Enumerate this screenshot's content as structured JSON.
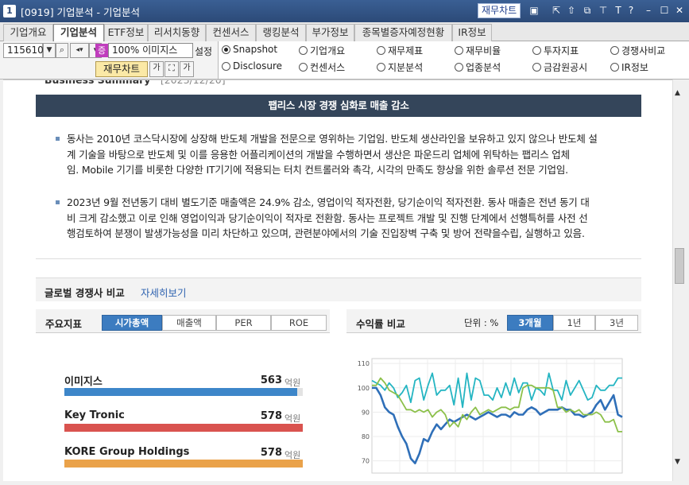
{
  "window": {
    "num": "1",
    "title": "[0919] 기업분석 - 기업분석",
    "fin_chart_btn": "재무차트",
    "icons": [
      "chart-icon",
      "arrow-up-icon",
      "window-icon",
      "window-icon-2",
      "pin-icon",
      "font-icon",
      "help-icon",
      "minimize-icon",
      "maximize-icon",
      "close-icon"
    ]
  },
  "tabs": [
    "기업개요",
    "기업분석",
    "ETF정보",
    "리서치동향",
    "컨센서스",
    "랭킹분석",
    "부가정보",
    "종목별증자예정현황",
    "IR정보"
  ],
  "active_tab": "기업분석",
  "controls": {
    "code": "115610",
    "zoom": "100%",
    "zoom_prefix": "증",
    "company": "이미지스",
    "settings": "설정",
    "fin_chart": "재무차트",
    "small_btns": [
      "가",
      "⛶",
      "가"
    ]
  },
  "radios": [
    {
      "label": "Snapshot",
      "checked": true
    },
    {
      "label": "기업개요",
      "checked": false
    },
    {
      "label": "재무제표",
      "checked": false
    },
    {
      "label": "재무비율",
      "checked": false
    },
    {
      "label": "투자지표",
      "checked": false
    },
    {
      "label": "경쟁사비교",
      "checked": false
    },
    {
      "label": "Disclosure",
      "checked": false
    },
    {
      "label": "컨센서스",
      "checked": false
    },
    {
      "label": "지분분석",
      "checked": false
    },
    {
      "label": "업종분석",
      "checked": false
    },
    {
      "label": "금감원공시",
      "checked": false
    },
    {
      "label": "IR정보",
      "checked": false
    }
  ],
  "summary": {
    "heading": "Business Summary",
    "date": "[2023/12/20]",
    "banner": "팹리스 시장 경쟁 심화로 매출 감소",
    "para1": [
      "동사는 2010년 코스닥시장에 상장해 반도체 개발을 전문으로 영위하는 기업임. 반도체 생산라인을 보유하고 있지 않으나 반도체 설",
      "계 기술을 바탕으로 반도체 및 이를 응용한 어플리케이션의 개발을 수행하면서 생산은 파운드리 업체에 위탁하는 팹리스 업체",
      "임. Mobile 기기를 비롯한 다양한 IT기기에 적용되는 터치 컨트롤러와 촉각, 시각의 만족도 향상을 위한 솔루션 전문 기업임."
    ],
    "para2": [
      "2023년 9월 전년동기 대비 별도기준 매출액은 24.9% 감소, 영업이익 적자전환, 당기순이익 적자전환. 동사 매출은 전년 동기 대",
      "비 크게 감소했고 이로 인해 영업이익과 당기순이익이 적자로 전환함. 동사는 프로젝트 개발 및 진행 단계에서 선행특허를 사전 선",
      "행검토하여 분쟁이 발생가능성을 미리 차단하고 있으며, 관련분야에서의 기술 진입장벽 구축 및 방어 전략을수립, 실행하고 있음."
    ]
  },
  "global": {
    "title": "글로벌 경쟁사 비교",
    "more": "자세히보기"
  },
  "indicators": {
    "title": "주요지표",
    "tabs": [
      "시가총액",
      "매출액",
      "PER",
      "ROE"
    ],
    "active": "시가총액",
    "unit": "억원",
    "companies": [
      {
        "name": "이미지스",
        "value": "563",
        "fill": 0.976,
        "color": "#3d86c9"
      },
      {
        "name": "Key Tronic",
        "value": "578",
        "fill": 1.0,
        "color": "#d9534f"
      },
      {
        "name": "KORE Group Holdings",
        "value": "578",
        "fill": 1.0,
        "color": "#eaa24a"
      }
    ]
  },
  "returns": {
    "title": "수익률 비교",
    "unit_label": "단위 : %",
    "tabs": [
      "3개월",
      "1년",
      "3년"
    ],
    "active": "3개월"
  },
  "chart_data": {
    "type": "line",
    "title": "",
    "xlabel": "",
    "ylabel": "",
    "ylim": [
      65,
      112
    ],
    "yticks": [
      70,
      80,
      90,
      100,
      110
    ],
    "grid": true,
    "series": [
      {
        "color": "#2f6fb8",
        "values": [
          100,
          100,
          97,
          92,
          90,
          89,
          84,
          80,
          77,
          71,
          69,
          73,
          79,
          78,
          82,
          85,
          83,
          85,
          87,
          86,
          87,
          88,
          89,
          88,
          87,
          88,
          89,
          90,
          89,
          88,
          89,
          89,
          88,
          90,
          89,
          89,
          91,
          92,
          91,
          89,
          90,
          91,
          91,
          91,
          92,
          91,
          91,
          89,
          89,
          88,
          89,
          90,
          93,
          95,
          91,
          94,
          97,
          89,
          88
        ]
      },
      {
        "color": "#24b5c2",
        "values": [
          103,
          102,
          101,
          99,
          102,
          100,
          96,
          98,
          101,
          94,
          103,
          104,
          95,
          101,
          106,
          97,
          99,
          99,
          101,
          93,
          104,
          92,
          106,
          95,
          104,
          103,
          97,
          97,
          95,
          100,
          96,
          102,
          97,
          104,
          98,
          102,
          102,
          95,
          100,
          99,
          97,
          106,
          99,
          99,
          95,
          103,
          97,
          100,
          103,
          99,
          95,
          96,
          101,
          99,
          99,
          101,
          101,
          104,
          104
        ]
      },
      {
        "color": "#8cc04a",
        "values": [
          101,
          101,
          104,
          102,
          99,
          98,
          97,
          94,
          91,
          91,
          90,
          91,
          90,
          91,
          88,
          90,
          91,
          89,
          84,
          86,
          84,
          89,
          87,
          90,
          92,
          89,
          90,
          91,
          90,
          91,
          92,
          92,
          91,
          92,
          92,
          100,
          101,
          101,
          100,
          100,
          100,
          100,
          99,
          92,
          92,
          90,
          91,
          90,
          91,
          89,
          89,
          89,
          90,
          89,
          86,
          86,
          87,
          82,
          82
        ]
      }
    ]
  }
}
